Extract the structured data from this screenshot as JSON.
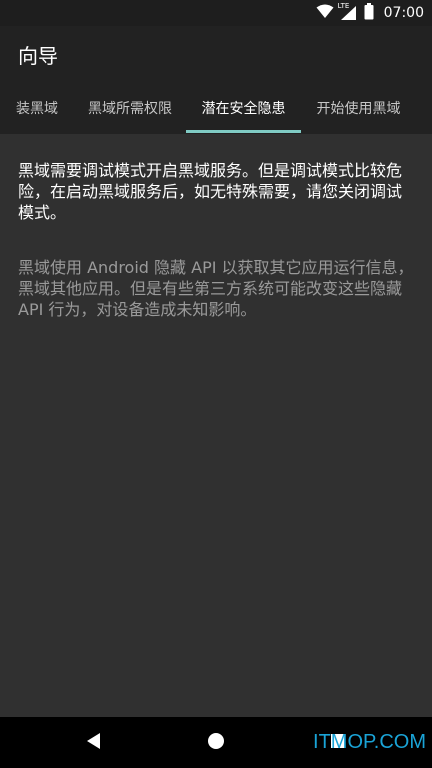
{
  "status_bar": {
    "network_label": "LTE",
    "time": "07:00"
  },
  "app_bar": {
    "title": "向导"
  },
  "tabs": [
    {
      "label": "装黑域",
      "active": false
    },
    {
      "label": "黑域所需权限",
      "active": false
    },
    {
      "label": "潜在安全隐患",
      "active": true
    },
    {
      "label": "开始使用黑域",
      "active": false
    }
  ],
  "content": {
    "paragraph_1": "黑域需要调试模式开启黑域服务。但是调试模式比较危险，在启动黑域服务后，如无特殊需要，请您关闭调试模式。",
    "paragraph_2": "黑域使用 Android 隐藏 API 以获取其它应用运行信息，黑域其他应用。但是有些第三方系统可能改变这些隐藏 API 行为，对设备造成未知影响。"
  },
  "nav_bar": {
    "icons": [
      "back-icon",
      "home-icon",
      "recents-icon"
    ]
  },
  "watermark": "ITMOP.COM",
  "colors": {
    "background": "#303030",
    "app_bar": "#222222",
    "tab_indicator": "#80cbc4",
    "watermark": "#1aa3d6"
  }
}
